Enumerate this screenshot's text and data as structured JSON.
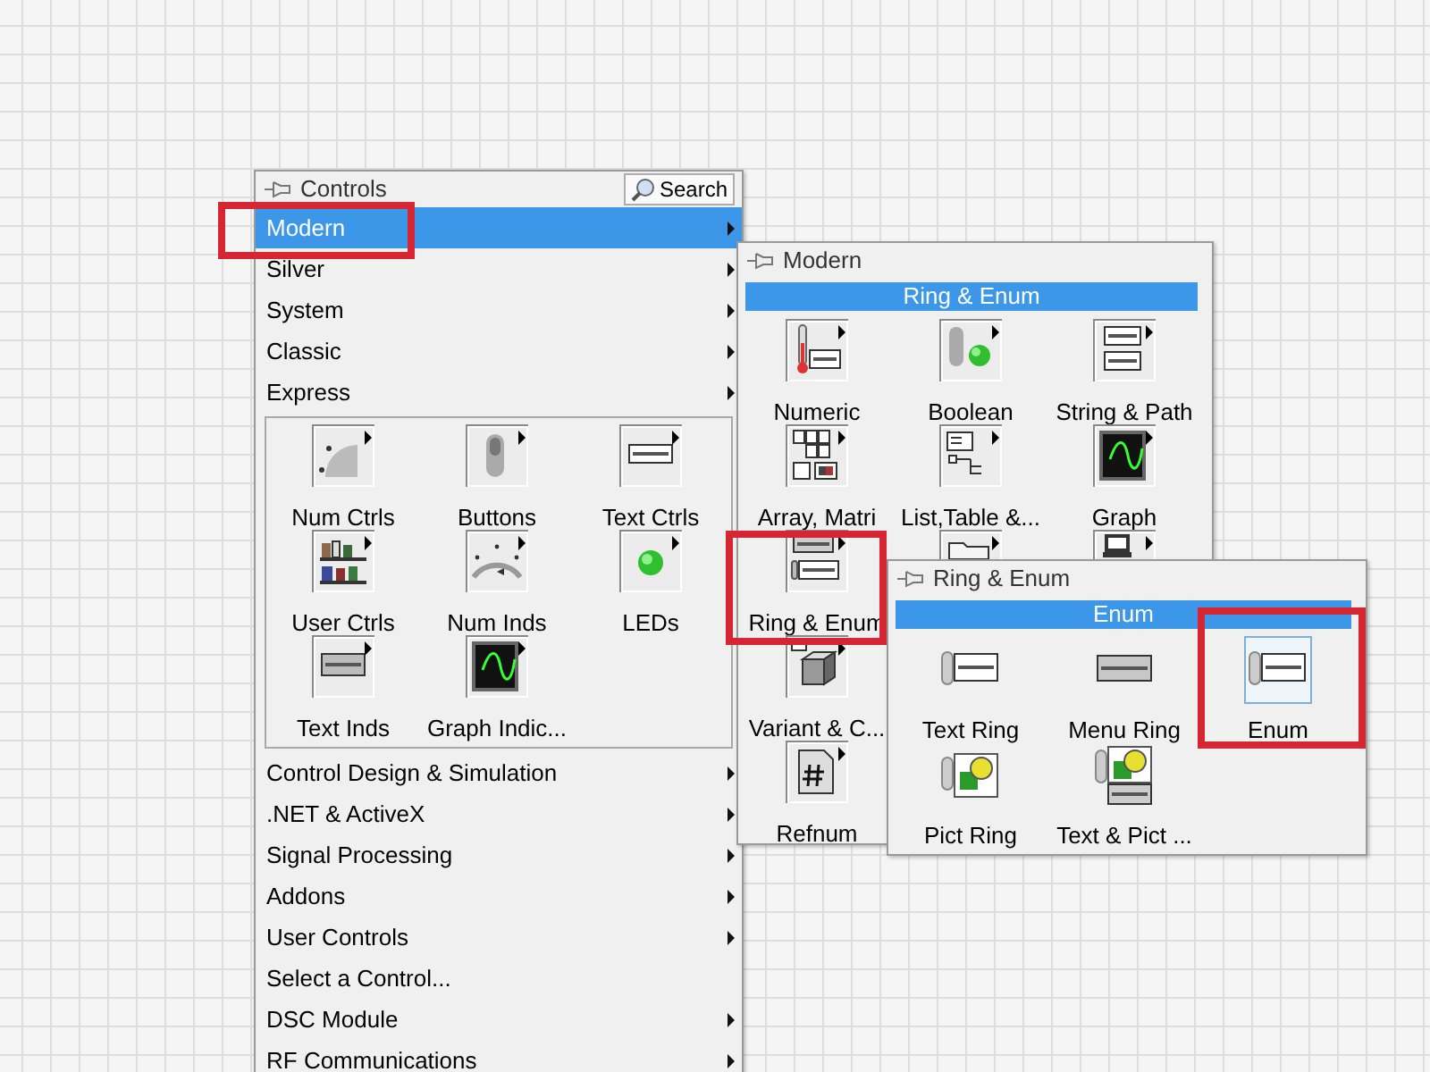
{
  "controls_palette": {
    "title": "Controls",
    "search_button": "Search",
    "menu_top": [
      {
        "label": "Modern",
        "has_submenu": true,
        "selected": true,
        "marked": true
      },
      {
        "label": "Silver",
        "has_submenu": true,
        "selected": false,
        "marked": false
      },
      {
        "label": "System",
        "has_submenu": true,
        "selected": false,
        "marked": false
      },
      {
        "label": "Classic",
        "has_submenu": true,
        "selected": false,
        "marked": false
      },
      {
        "label": "Express",
        "has_submenu": true,
        "selected": false,
        "marked": false
      }
    ],
    "icon_rows": [
      [
        {
          "label": "Num Ctrls"
        },
        {
          "label": "Buttons"
        },
        {
          "label": "Text Ctrls"
        }
      ],
      [
        {
          "label": "User Ctrls"
        },
        {
          "label": "Num Inds"
        },
        {
          "label": "LEDs"
        }
      ],
      [
        {
          "label": "Text Inds"
        },
        {
          "label": "Graph Indic..."
        }
      ]
    ],
    "menu_bottom": [
      {
        "label": "Control Design & Simulation",
        "has_submenu": true,
        "selected": false,
        "marked": false
      },
      {
        "label": ".NET & ActiveX",
        "has_submenu": true,
        "selected": false,
        "marked": false
      },
      {
        "label": "Signal Processing",
        "has_submenu": true,
        "selected": false,
        "marked": false
      },
      {
        "label": "Addons",
        "has_submenu": true,
        "selected": false,
        "marked": false
      },
      {
        "label": "User Controls",
        "has_submenu": true,
        "selected": false,
        "marked": false
      },
      {
        "label": "Select a Control...",
        "has_submenu": false,
        "selected": false,
        "marked": false
      },
      {
        "label": "DSC Module",
        "has_submenu": true,
        "selected": false,
        "marked": false
      },
      {
        "label": "RF Communications",
        "has_submenu": true,
        "selected": false,
        "marked": false
      }
    ]
  },
  "modern_panel": {
    "title": "Modern",
    "highlight": "Ring & Enum",
    "rows": [
      [
        {
          "label": "Numeric",
          "marked": false
        },
        {
          "label": "Boolean",
          "marked": false
        },
        {
          "label": "String & Path",
          "marked": false
        }
      ],
      [
        {
          "label": "Array, Matri",
          "marked": false
        },
        {
          "label": "List,Table &...",
          "marked": false
        },
        {
          "label": "Graph",
          "marked": false
        }
      ],
      [
        {
          "label": "Ring & Enum",
          "marked": true
        },
        {
          "marked": false
        },
        {
          "marked": false
        }
      ],
      [
        {
          "label": "Variant & C...",
          "marked": false
        }
      ],
      [
        {
          "label": "Refnum",
          "marked": false
        }
      ]
    ]
  },
  "ring_enum_panel": {
    "title": "Ring & Enum",
    "highlight": "Enum",
    "rows": [
      [
        {
          "label": "Text Ring",
          "selected": false,
          "marked": false
        },
        {
          "label": "Menu Ring",
          "selected": false,
          "marked": false
        },
        {
          "label": "Enum",
          "selected": true,
          "marked": true
        }
      ],
      [
        {
          "label": "Pict Ring",
          "selected": false,
          "marked": false
        },
        {
          "label": "Text & Pict ...",
          "selected": false,
          "marked": false
        }
      ]
    ]
  }
}
